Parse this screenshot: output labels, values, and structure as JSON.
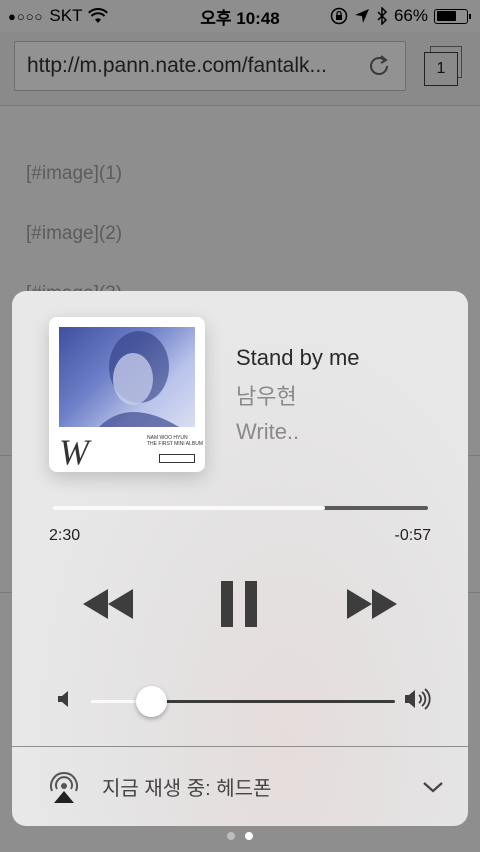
{
  "status_bar": {
    "signal": "●○○○",
    "carrier": "SKT",
    "time": "오후 10:48",
    "battery_percent": "66%",
    "battery_level": 0.66
  },
  "browser": {
    "url": "http://m.pann.nate.com/fantalk...",
    "tab_count": "1"
  },
  "page": {
    "lines": [
      "[#image](1)",
      "[#image](2)",
      "[#image](3)"
    ]
  },
  "now_playing": {
    "artwork_letter": "W",
    "artwork_caption": "NAM WOO HYUN\nTHE FIRST MINI ALBUM",
    "title": "Stand by me",
    "artist": "남우현",
    "album": "Write..",
    "elapsed": "2:30",
    "remaining": "-0:57",
    "progress": 0.725,
    "volume": 0.2,
    "output_label": "지금 재생 중: 헤드폰"
  },
  "colors": {
    "card_bg": "#e6e6e6",
    "artwork_tint": "#5566b8",
    "control_dark": "#3d3d3d"
  },
  "page_indicator": {
    "count": 2,
    "active": 1
  }
}
